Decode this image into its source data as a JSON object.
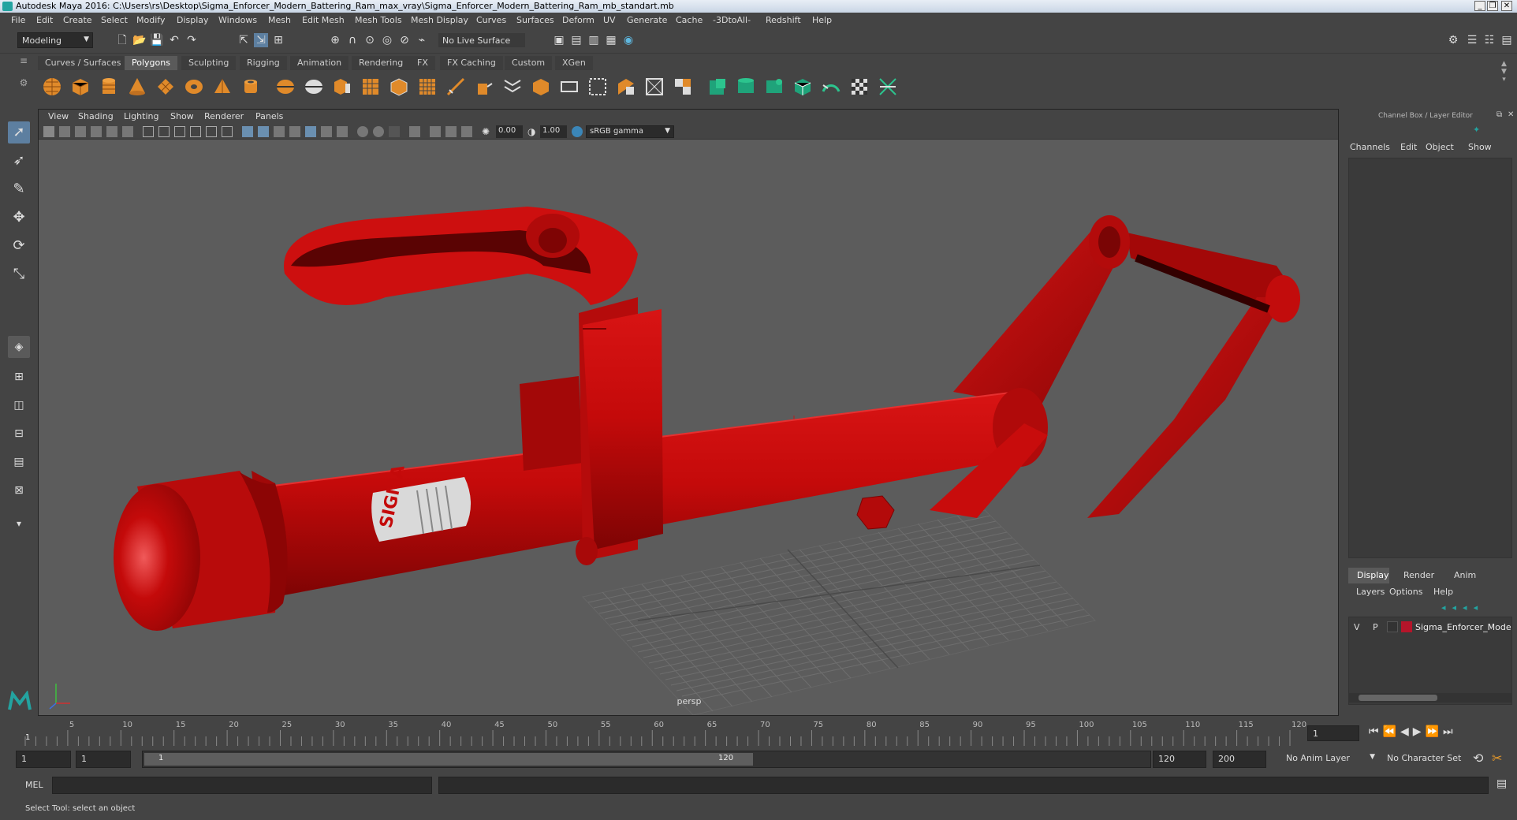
{
  "window": {
    "title": "Autodesk Maya 2016: C:\\Users\\rs\\Desktop\\Sigma_Enforcer_Modern_Battering_Ram_max_vray\\Sigma_Enforcer_Modern_Battering_Ram_mb_standart.mb",
    "minimize": "_",
    "restore": "❐",
    "close": "✕"
  },
  "menubar": [
    "File",
    "Edit",
    "Create",
    "Select",
    "Modify",
    "Display",
    "Windows",
    "Mesh",
    "Edit Mesh",
    "Mesh Tools",
    "Mesh Display",
    "Curves",
    "Surfaces",
    "Deform",
    "UV",
    "Generate",
    "Cache",
    "-3DtoAll-",
    "Redshift",
    "Help"
  ],
  "statusline": {
    "mode": "Modeling",
    "live_surface": "No Live Surface"
  },
  "shelf": {
    "tabs": [
      "Curves / Surfaces",
      "Polygons",
      "Sculpting",
      "Rigging",
      "Animation",
      "Rendering",
      "FX",
      "FX Caching",
      "Custom",
      "XGen"
    ],
    "active_tab": "Polygons"
  },
  "viewport": {
    "menu": [
      "View",
      "Shading",
      "Lighting",
      "Show",
      "Renderer",
      "Panels"
    ],
    "exposure": "0.00",
    "gamma": "1.00",
    "color_space": "sRGB gamma",
    "camera_label": "persp",
    "decal_text": "SIGMA"
  },
  "channel_box": {
    "title": "Channel Box / Layer Editor",
    "menu": [
      "Channels",
      "Edit",
      "Object",
      "Show"
    ],
    "layer_tabs": [
      "Display",
      "Render",
      "Anim"
    ],
    "layer_menu": [
      "Layers",
      "Options",
      "Help"
    ],
    "layer": {
      "v": "V",
      "p": "P",
      "name": "Sigma_Enforcer_Mode",
      "color": "#b5152a"
    }
  },
  "timeline": {
    "ticks": [
      "5",
      "10",
      "15",
      "20",
      "25",
      "30",
      "35",
      "40",
      "45",
      "50",
      "55",
      "60",
      "65",
      "70",
      "75",
      "80",
      "85",
      "90",
      "95",
      "100",
      "105",
      "110",
      "115",
      "120"
    ],
    "start_tick": "1",
    "current_frame": "1"
  },
  "range": {
    "start": "1",
    "playback_start": "1",
    "slider_start": "1",
    "slider_end": "120",
    "playback_end": "120",
    "end": "200",
    "anim_layer": "No Anim Layer",
    "character_set": "No Character Set"
  },
  "command": {
    "lang": "MEL"
  },
  "help_line": "Select Tool: select an object",
  "colors": {
    "model_red": "#c40a0a",
    "accent_teal": "#23a3a0",
    "active_tool": "#5d7fa0"
  }
}
